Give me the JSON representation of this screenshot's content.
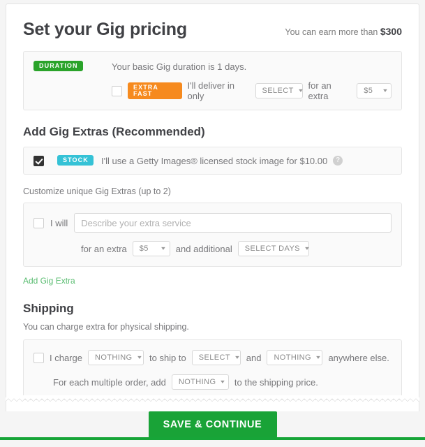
{
  "header": {
    "title": "Set your Gig pricing",
    "earn_prefix": "You can earn more than",
    "earn_amount": "$300"
  },
  "duration": {
    "badge": "DURATION",
    "basic_text": "Your basic Gig duration is 1 days.",
    "extra_fast_badge": "EXTRA FAST",
    "deliver_text": "I'll deliver in only",
    "days_select": "SELECT",
    "for_extra_text": "for an extra",
    "price_select": "$5",
    "checkbox_checked": false
  },
  "gig_extras": {
    "heading": "Add Gig Extras (Recommended)",
    "stock": {
      "badge": "STOCK",
      "text": "I'll use a Getty Images® licensed stock image for $10.00",
      "help_icon": "?",
      "checkbox_checked": true
    },
    "customize_label": "Customize unique Gig Extras (up to 2)",
    "custom": {
      "i_will_label": "I will",
      "describe_placeholder": "Describe your extra service",
      "describe_value": "",
      "for_extra_text": "for an extra",
      "price_select": "$5",
      "and_additional_text": "and additional",
      "days_select": "SELECT DAYS",
      "checkbox_checked": false
    },
    "add_extra_link": "Add Gig Extra"
  },
  "shipping": {
    "heading": "Shipping",
    "subtitle": "You can charge extra for physical shipping.",
    "i_charge_label": "I charge",
    "charge_select": "NOTHING",
    "to_ship_to_text": "to ship to",
    "destination_select": "SELECT",
    "and_text": "and",
    "elsewhere_select": "NOTHING",
    "anywhere_else_text": "anywhere else.",
    "multiple_order_text": "For each multiple order, add",
    "multiple_select": "NOTHING",
    "to_shipping_price_text": "to the shipping price.",
    "checkbox_checked": false
  },
  "footer": {
    "save_button": "SAVE & CONTINUE"
  },
  "colors": {
    "green_badge": "#2aa32a",
    "orange_badge": "#f68a1e",
    "teal_badge": "#35c2d6",
    "save_green": "#19a337",
    "link_green": "#5bbd72"
  },
  "icons": {
    "caret": "▾"
  }
}
